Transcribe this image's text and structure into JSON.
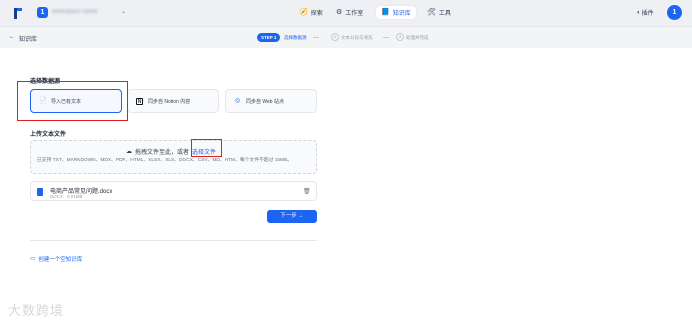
{
  "topbar": {
    "workspace_initial": "1",
    "workspace_name": "workspace name",
    "nav": [
      {
        "icon": "🧭",
        "label": "探索"
      },
      {
        "icon": "⚙",
        "label": "工作室"
      },
      {
        "icon": "📘",
        "label": "知识库"
      },
      {
        "icon": "🛠",
        "label": "工具"
      }
    ],
    "plugin_label": "插件",
    "avatar_initial": "1"
  },
  "subbar": {
    "back_label": "知识库",
    "steps": [
      {
        "num": "STEP 1",
        "label": "选择数据源"
      },
      {
        "num": "2",
        "label": "文本分段与清洗"
      },
      {
        "num": "3",
        "label": "处理并完成"
      }
    ]
  },
  "main": {
    "source_title": "选择数据源",
    "sources": [
      {
        "icon": "📄",
        "label": "导入已有文本"
      },
      {
        "icon": "N",
        "label": "同步自 Notion 内容"
      },
      {
        "icon": "◎",
        "label": "同步自 Web 站点"
      }
    ],
    "upload_title": "上传文本文件",
    "drop_text": "拖拽文件至此，或者",
    "drop_link": "选择文件",
    "supported": "已支持 TXT、MARKDOWN、MDX、PDF、HTML、XLSX、XLS、DOCX、CSV、MD、HTM，每个文件不超过 15MB。",
    "file": {
      "name": "电商产品常见问题.docx",
      "meta": "DOCX · 0.01MB"
    },
    "next_label": "下一步 →",
    "create_empty": "创建一个空知识库"
  },
  "watermark": "大数跨境",
  "colors": {
    "accent": "#1c64f2",
    "highlight": "#e02020"
  }
}
